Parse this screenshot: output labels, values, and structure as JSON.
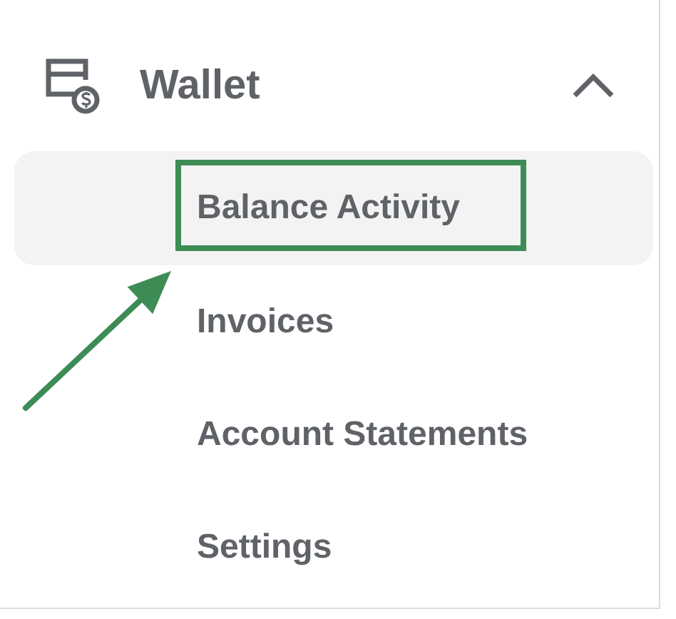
{
  "menu": {
    "label": "Wallet",
    "expanded": true,
    "items": [
      {
        "label": "Balance Activity",
        "selected": true,
        "annotated": true
      },
      {
        "label": "Invoices",
        "selected": false,
        "annotated": false
      },
      {
        "label": "Account Statements",
        "selected": false,
        "annotated": false
      },
      {
        "label": "Settings",
        "selected": false,
        "annotated": false
      }
    ]
  }
}
